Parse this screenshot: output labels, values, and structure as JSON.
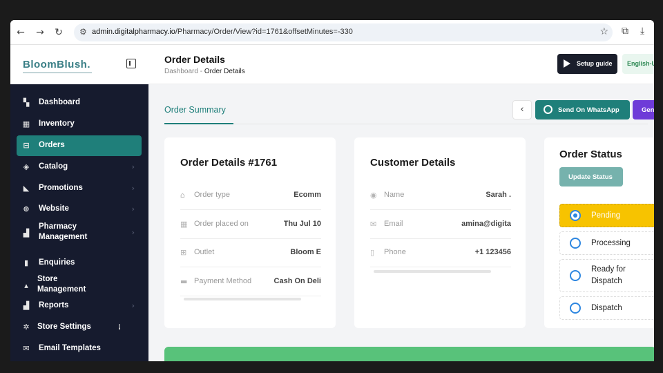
{
  "browser": {
    "back": "←",
    "forward": "→",
    "reload": "↻",
    "site_info": "⚙",
    "url_host": "admin.digitalpharmacy.io",
    "url_path": "/Pharmacy/Order/View?id=1761&offsetMinutes=-330",
    "star": "☆",
    "extensions": "⧉",
    "download": "⤓"
  },
  "header": {
    "logo": "BloomBlush.",
    "page_title": "Order Details",
    "breadcrumb_home": "Dashboard",
    "breadcrumb_sep": "-",
    "breadcrumb_current": "Order Details",
    "setup_label": "Setup guide",
    "lang_label": "English-U"
  },
  "sidebar": {
    "items": [
      {
        "label": "Dashboard",
        "icon": "▚",
        "chevron": ""
      },
      {
        "label": "Inventory",
        "icon": "▦",
        "chevron": ""
      },
      {
        "label": "Orders",
        "icon": "⊟",
        "chevron": ""
      },
      {
        "label": "Catalog",
        "icon": "◈",
        "chevron": "›"
      },
      {
        "label": "Promotions",
        "icon": "◣",
        "chevron": "›"
      },
      {
        "label": "Website",
        "icon": "⊕",
        "chevron": "›"
      },
      {
        "label": "Pharmacy Management",
        "icon": "▟",
        "chevron": "›"
      },
      {
        "label": "Enquiries",
        "icon": "▮",
        "chevron": ""
      },
      {
        "label": "Store Management",
        "icon": "▴",
        "chevron": ""
      },
      {
        "label": "Reports",
        "icon": "▟",
        "chevron": "›"
      },
      {
        "label": "Store Settings",
        "icon": "✲",
        "chevron": "⁝"
      },
      {
        "label": "Email Templates",
        "icon": "✉",
        "chevron": ""
      }
    ]
  },
  "main": {
    "tab": "Order Summary",
    "back": "‹",
    "whatsapp_label": "Send On WhatsApp",
    "gen_label": "Gen",
    "order_card": {
      "title": "Order Details #1761",
      "rows": [
        {
          "icon": "⌂",
          "key": "Order type",
          "value": "Ecomm"
        },
        {
          "icon": "▦",
          "key": "Order placed on",
          "value": "Thu Jul 10"
        },
        {
          "icon": "⊞",
          "key": "Outlet",
          "value": "Bloom E"
        },
        {
          "icon": "▬",
          "key": "Payment Method",
          "value": "Cash On Deli"
        }
      ]
    },
    "customer_card": {
      "title": "Customer Details",
      "rows": [
        {
          "icon": "◉",
          "key": "Name",
          "value": "Sarah ."
        },
        {
          "icon": "✉",
          "key": "Email",
          "value": "amina@digita"
        },
        {
          "icon": "▯",
          "key": "Phone",
          "value": "+1 123456"
        }
      ]
    },
    "status_card": {
      "title": "Order Status",
      "update_label": "Update Status",
      "steps": [
        {
          "label": "Pending",
          "active": true
        },
        {
          "label": "Processing",
          "active": false
        },
        {
          "label": "Ready for Dispatch",
          "active": false
        },
        {
          "label": "Dispatch",
          "active": false
        }
      ]
    }
  },
  "colors": {
    "brand": "#1f7f7a",
    "sidebar_bg": "#161b2e",
    "pending": "#f7c300",
    "whatsapp": "#1f7f7a",
    "generate": "#6e3bd8"
  }
}
